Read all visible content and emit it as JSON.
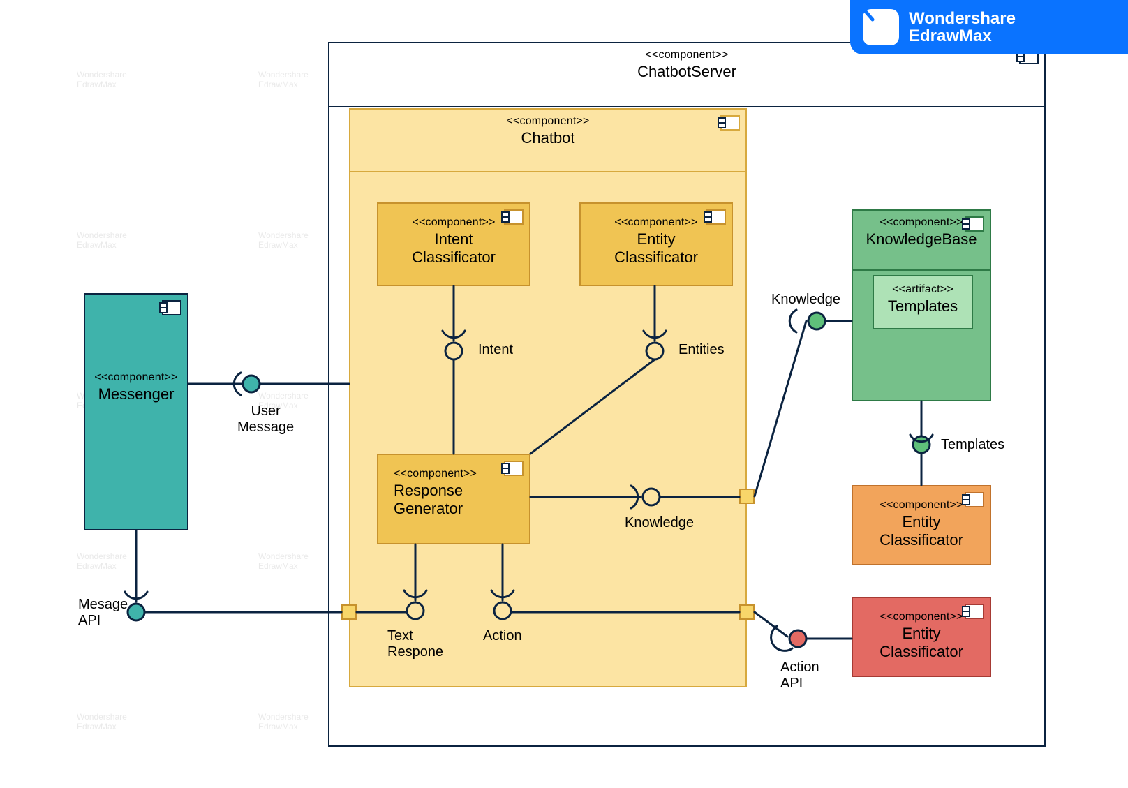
{
  "brand": {
    "line1": "Wondershare",
    "line2": "EdrawMax"
  },
  "watermark": {
    "line1": "Wondershare",
    "line2": "EdrawMax"
  },
  "stereotypes": {
    "component": "<<component>>",
    "artifact": "<<artifact>>"
  },
  "server": {
    "name": "ChatbotServer"
  },
  "chatbot": {
    "name": "Chatbot"
  },
  "components": {
    "messenger": {
      "name": "Messenger"
    },
    "intent": {
      "name": "Intent\nClassificator"
    },
    "entity": {
      "name": "Entity\nClassificator"
    },
    "response": {
      "name": "Response\nGenerator"
    },
    "knowledge": {
      "name": "KnowledgeBase"
    },
    "templatesArtifact": {
      "name": "Templates"
    },
    "orangeEntity": {
      "name": "Entity\nClassificator"
    },
    "redEntity": {
      "name": "Entity\nClassificator"
    }
  },
  "interfaces": {
    "userMessage": "User\nMessage",
    "messageAPI": "Mesage\nAPI",
    "intent": "Intent",
    "entities": "Entities",
    "knowledgeTop": "Knowledge",
    "knowledgeIn": "Knowledge",
    "templates": "Templates",
    "textResponse": "Text\nRespone",
    "action": "Action",
    "actionAPI": "Action\nAPI"
  },
  "colors": {
    "border": "#0b2340",
    "tealFill": "#3fb3ab",
    "tealBorder": "#0b2340",
    "yellowLight": "#fce4a3",
    "yellowDark": "#f0c453",
    "greenFill": "#76c08a",
    "greenLight": "#aee2b6",
    "orangeFill": "#f2a45b",
    "redFill": "#e36a63",
    "portYellow": "#f8d66a",
    "portTeal": "#3fb3ab",
    "portGreen": "#5fc07a",
    "portRed": "#e36a63",
    "line": "#0b2340"
  }
}
